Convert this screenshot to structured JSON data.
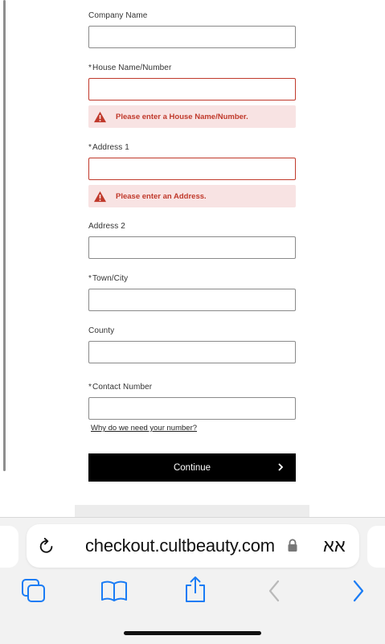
{
  "form": {
    "company_name": {
      "label": "Company Name",
      "required": false
    },
    "house": {
      "label": "House Name/Number",
      "required": true,
      "error": "Please enter a House Name/Number."
    },
    "address1": {
      "label": "Address 1",
      "required": true,
      "error": "Please enter an Address."
    },
    "address2": {
      "label": "Address 2",
      "required": false
    },
    "town": {
      "label": "Town/City",
      "required": true
    },
    "county": {
      "label": "County",
      "required": false
    },
    "contact": {
      "label": "Contact Number",
      "required": true
    },
    "required_marker": "*",
    "help_link": "Why do we need your number?",
    "continue_label": "Continue"
  },
  "browser": {
    "url": "checkout.cultbeauty.com",
    "aa_label": "אא",
    "icons": [
      "reload-icon",
      "lock-icon",
      "tabs-icon",
      "bookmarks-icon",
      "share-icon",
      "back-icon",
      "forward-icon"
    ]
  },
  "colors": {
    "error": "#c0392b",
    "error_bg": "#f8e3e3",
    "button_bg": "#000000",
    "toolbar_blue": "#1a7cf5",
    "toolbar_disabled": "#b9b9b9"
  }
}
